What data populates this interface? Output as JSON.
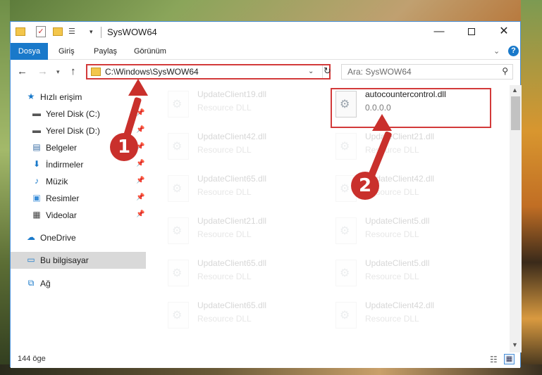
{
  "window": {
    "title": "SysWOW64"
  },
  "ribbon": {
    "tabs": [
      "Dosya",
      "Giriş",
      "Paylaş",
      "Görünüm"
    ]
  },
  "navbar": {
    "address": "C:\\Windows\\SysWOW64",
    "search_placeholder": "Ara: SysWOW64"
  },
  "sidebar": {
    "items": [
      {
        "label": "Hızlı erişim",
        "icon": "star-icon",
        "pinned": false
      },
      {
        "label": "Yerel Disk (C:)",
        "icon": "drive-icon",
        "pinned": true
      },
      {
        "label": "Yerel Disk (D:)",
        "icon": "drive-icon",
        "pinned": true
      },
      {
        "label": "Belgeler",
        "icon": "document-icon",
        "pinned": true
      },
      {
        "label": "İndirmeler",
        "icon": "download-icon",
        "pinned": true
      },
      {
        "label": "Müzik",
        "icon": "music-icon",
        "pinned": true
      },
      {
        "label": "Resimler",
        "icon": "pictures-icon",
        "pinned": true
      },
      {
        "label": "Videolar",
        "icon": "videos-icon",
        "pinned": true
      },
      {
        "label": "OneDrive",
        "icon": "cloud-icon",
        "pinned": false
      },
      {
        "label": "Bu bilgisayar",
        "icon": "computer-icon",
        "pinned": false,
        "selected": true
      },
      {
        "label": "Ağ",
        "icon": "network-icon",
        "pinned": false
      }
    ]
  },
  "files": [
    {
      "name": "UpdateClient19.dll",
      "desc": "Resource DLL"
    },
    {
      "name": "autocountercontrol.dll",
      "desc": "0.0.0.0",
      "highlighted": true
    },
    {
      "name": "UpdateClient42.dll",
      "desc": "Resource DLL"
    },
    {
      "name": "UpdateClient21.dll",
      "desc": "Resource DLL"
    },
    {
      "name": "UpdateClient65.dll",
      "desc": "Resource DLL"
    },
    {
      "name": "UpdateClient42.dll",
      "desc": "Resource DLL"
    },
    {
      "name": "UpdateClient21.dll",
      "desc": "Resource DLL"
    },
    {
      "name": "UpdateClient5.dll",
      "desc": "Resource DLL"
    },
    {
      "name": "UpdateClient65.dll",
      "desc": "Resource DLL"
    },
    {
      "name": "UpdateClient5.dll",
      "desc": "Resource DLL"
    },
    {
      "name": "UpdateClient65.dll",
      "desc": "Resource DLL"
    },
    {
      "name": "UpdateClient42.dll",
      "desc": "Resource DLL"
    }
  ],
  "status": {
    "item_count": "144 öge"
  },
  "callouts": {
    "step1": "1",
    "step2": "2"
  },
  "colors": {
    "accent": "#1979ca",
    "callout": "#c9302c"
  }
}
